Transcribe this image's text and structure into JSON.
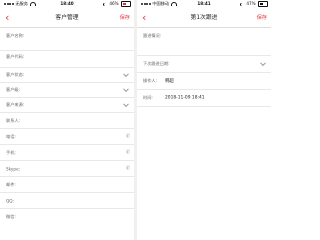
{
  "colors": {
    "accent": "#e2373f",
    "divider": "#e8e8e8",
    "label": "#666666"
  },
  "left_screen": {
    "status": {
      "carrier": "无服务",
      "time": "18:40",
      "battery": "46%"
    },
    "nav": {
      "back_icon": "chevron-left-icon",
      "title": "客户管理",
      "save": "保存"
    },
    "fields": [
      {
        "label": "客户名称:",
        "accessory": ""
      },
      {
        "label": "客户代码:",
        "accessory": ""
      },
      {
        "label": "客户状态:",
        "accessory": "chevron-down-icon"
      },
      {
        "label": "客户级:",
        "accessory": "chevron-down-icon"
      },
      {
        "label": "客户来源:",
        "accessory": "chevron-down-icon"
      },
      {
        "label": "联系人:",
        "accessory": ""
      },
      {
        "label": "电话:",
        "accessory": "phone-icon"
      },
      {
        "label": "手机:",
        "accessory": "phone-icon"
      },
      {
        "label": "Skype:",
        "accessory": "phone-icon"
      },
      {
        "label": "邮件:",
        "accessory": ""
      },
      {
        "label": "QQ:",
        "accessory": ""
      },
      {
        "label": "微信:",
        "accessory": ""
      }
    ]
  },
  "right_screen": {
    "status": {
      "carrier": "中国移动",
      "time": "18:41",
      "battery": "47%"
    },
    "nav": {
      "back_icon": "chevron-left-icon",
      "title": "第1次跟进",
      "save": "保存"
    },
    "fields": [
      {
        "label": "跟进情况:",
        "value": ""
      },
      {
        "label": "下次跟进日期:",
        "value": ""
      },
      {
        "label": "操作人:",
        "value": "韩超"
      },
      {
        "label": "时间:",
        "value": "2018-11-09 18:41"
      }
    ]
  }
}
